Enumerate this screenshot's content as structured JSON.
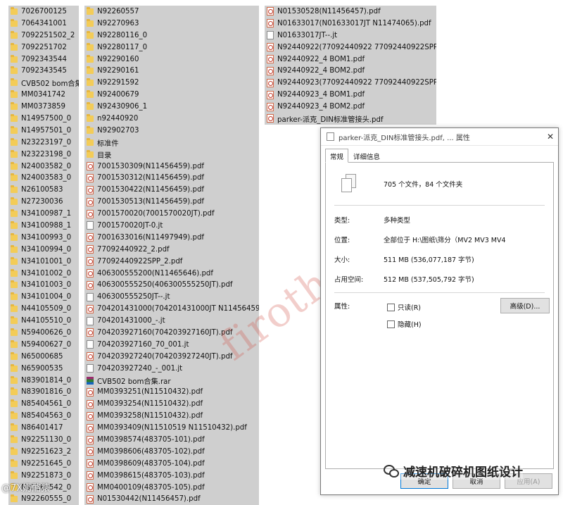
{
  "col1": [
    "7026700125",
    "7064341001",
    "7092251502_2",
    "7092251702",
    "7092343544",
    "7092343545",
    "CVB502 bom合集",
    "MM0341742",
    "MM0373859",
    "N14957500_0",
    "N14957501_0",
    "N23223197_0",
    "N23223198_0",
    "N24003582_0",
    "N24003583_0",
    "N26100583",
    "N27230036",
    "N34100987_1",
    "N34100988_1",
    "N34100993_0",
    "N34100994_0",
    "N34101001_0",
    "N34101002_0",
    "N34101003_0",
    "N34101004_0",
    "N44105509_0",
    "N44105510_0",
    "N59400626_0",
    "N59400627_0",
    "N65000685",
    "N65900535",
    "N83901814_0",
    "N83901816_0",
    "N85404561_0",
    "N85404563_0",
    "N86401417",
    "N92251130_0",
    "N92251623_2",
    "N92251645_0",
    "N92251873_0",
    "N92260542_0",
    "N92260555_0"
  ],
  "col2": [
    {
      "t": "folder",
      "n": "N92260557"
    },
    {
      "t": "folder",
      "n": "N92270963"
    },
    {
      "t": "folder",
      "n": "N92280116_0"
    },
    {
      "t": "folder",
      "n": "N92280117_0"
    },
    {
      "t": "folder",
      "n": "N92290160"
    },
    {
      "t": "folder",
      "n": "N92290161"
    },
    {
      "t": "folder",
      "n": "N92291592"
    },
    {
      "t": "folder",
      "n": "N92400679"
    },
    {
      "t": "folder",
      "n": "N92430906_1"
    },
    {
      "t": "folder",
      "n": "n92440920"
    },
    {
      "t": "folder",
      "n": "N92902703"
    },
    {
      "t": "folder",
      "n": "标准件"
    },
    {
      "t": "folder",
      "n": "目录"
    },
    {
      "t": "pdf",
      "n": "7001530309(N11456459).pdf"
    },
    {
      "t": "pdf",
      "n": "7001530312(N11456459).pdf"
    },
    {
      "t": "pdf",
      "n": "7001530422(N11456459).pdf"
    },
    {
      "t": "pdf",
      "n": "7001530513(N11456459).pdf"
    },
    {
      "t": "pdf",
      "n": "7001570020(7001570020JT).pdf"
    },
    {
      "t": "file",
      "n": "7001570020JT-0.jt"
    },
    {
      "t": "pdf",
      "n": "7001633016(N11497949).pdf"
    },
    {
      "t": "pdf",
      "n": "77092440922_2.pdf"
    },
    {
      "t": "pdf",
      "n": "77092440922SPP_2.pdf"
    },
    {
      "t": "pdf",
      "n": "406300555200(N11465646).pdf"
    },
    {
      "t": "pdf",
      "n": "406300555250(406300555250JT).pdf"
    },
    {
      "t": "file",
      "n": "406300555250JT--.jt"
    },
    {
      "t": "pdf",
      "n": "704201431000(704201431000JT N11456459).pdf"
    },
    {
      "t": "file",
      "n": "704201431000_-.jt"
    },
    {
      "t": "pdf",
      "n": "704203927160(704203927160JT).pdf"
    },
    {
      "t": "file",
      "n": "704203927160_70_001.jt"
    },
    {
      "t": "pdf",
      "n": "704203927240(704203927240JT).pdf"
    },
    {
      "t": "file",
      "n": "704203927240_-_001.jt"
    },
    {
      "t": "rar",
      "n": "CVB502 bom合集.rar"
    },
    {
      "t": "pdf",
      "n": "MM0393251(N11510432).pdf"
    },
    {
      "t": "pdf",
      "n": "MM0393254(N11510432).pdf"
    },
    {
      "t": "pdf",
      "n": "MM0393258(N11510432).pdf"
    },
    {
      "t": "pdf",
      "n": "MM0393409(N11510519 N11510432).pdf"
    },
    {
      "t": "pdf",
      "n": "MM0398574(483705-101).pdf"
    },
    {
      "t": "pdf",
      "n": "MM0398606(483705-102).pdf"
    },
    {
      "t": "pdf",
      "n": "MM0398609(483705-104).pdf"
    },
    {
      "t": "pdf",
      "n": "MM0398615(483705-103).pdf"
    },
    {
      "t": "pdf",
      "n": "MM0400109(483705-105).pdf"
    },
    {
      "t": "pdf",
      "n": "N01530442(N11456457).pdf"
    }
  ],
  "col3": [
    {
      "t": "pdf",
      "n": "N01530528(N11456457).pdf"
    },
    {
      "t": "pdf",
      "n": "N01633017(N01633017JT N11474065).pdf"
    },
    {
      "t": "file",
      "n": "N01633017JT--.jt"
    },
    {
      "t": "pdf",
      "n": "N92440922(77092440922 77092440922SPP).pdf"
    },
    {
      "t": "pdf",
      "n": "N92440922_4 BOM1.pdf"
    },
    {
      "t": "pdf",
      "n": "N92440922_4 BOM2.pdf"
    },
    {
      "t": "pdf",
      "n": "N92440923(77092440922 77092440922SPP).pdf"
    },
    {
      "t": "pdf",
      "n": "N92440923_4 BOM1.pdf"
    },
    {
      "t": "pdf",
      "n": "N92440923_4 BOM2.pdf"
    },
    {
      "t": "pdf",
      "n": "parker-派克_DIN标准管接头.pdf"
    }
  ],
  "dialog": {
    "title": "parker-派克_DIN标准管接头.pdf, ... 属性",
    "close": "✕",
    "tabs": [
      "常规",
      "详细信息"
    ],
    "count": "705 个文件，84 个文件夹",
    "type_label": "类型:",
    "type_value": "多种类型",
    "loc_label": "位置:",
    "loc_value": "全部位于 H:\\图纸\\筛分（MV2 MV3 MV4",
    "size_label": "大小:",
    "size_value": "511 MB (536,077,187 字节)",
    "disk_label": "占用空间:",
    "disk_value": "512 MB (537,505,792 字节)",
    "attr_label": "属性:",
    "readonly": "只读(R)",
    "hidden": "隐藏(H)",
    "advanced": "高级(D)...",
    "ok": "确定",
    "cancel": "取消",
    "apply": "应用(A)"
  },
  "watermark": "firothreducer",
  "brand": "减速机破碎机图纸设计",
  "corner": "@7X奶酪猿"
}
